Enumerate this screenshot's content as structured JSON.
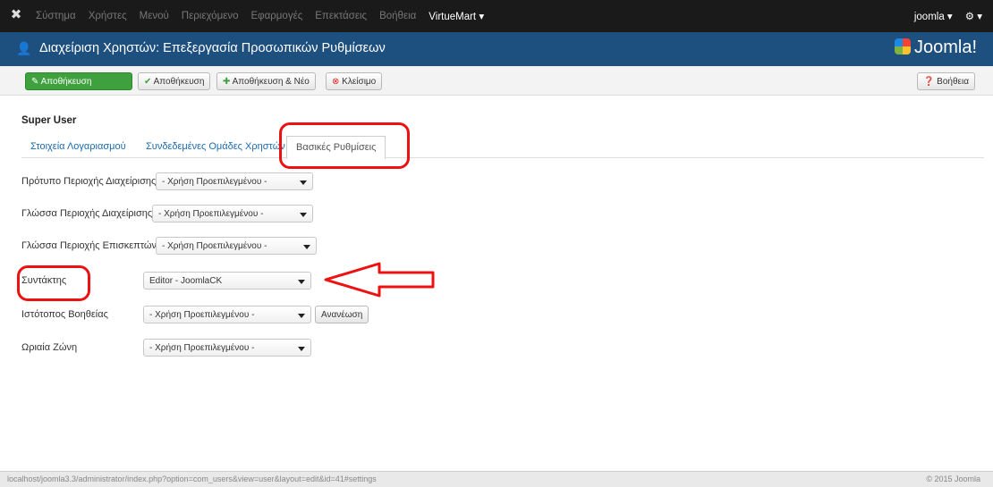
{
  "topnav": {
    "items": [
      "Σύστημα",
      "Χρήστες",
      "Μενού",
      "Περιεχόμενο",
      "Εφαρμογές",
      "Επεκτάσεις",
      "Βοήθεια",
      "VirtueMart ▾"
    ],
    "user": "joomla ▾",
    "gear": "⚙ ▾"
  },
  "titlebar": {
    "title": "Διαχείριση Χρηστών: Επεξεργασία Προσωπικών Ρυθμίσεων",
    "brand": "Joomla!"
  },
  "toolbar": {
    "save": "Αποθήκευση",
    "save2": "Αποθήκευση",
    "save_new": "Αποθήκευση & Νέο",
    "close": "Κλείσιμο",
    "help": "Βοήθεια"
  },
  "page": {
    "user": "Super User"
  },
  "tabs": [
    "Στοιχεία Λογαριασμού",
    "Συνδεδεμένες Ομάδες Χρηστών",
    "Βασικές Ρυθμίσεις"
  ],
  "fields": [
    {
      "label": "Πρότυπο Περιοχής Διαχείρισης",
      "value": "- Χρήση Προεπιλεγμένου -"
    },
    {
      "label": "Γλώσσα Περιοχής Διαχείρισης",
      "value": "- Χρήση Προεπιλεγμένου -"
    },
    {
      "label": "Γλώσσα Περιοχής Επισκεπτών",
      "value": "- Χρήση Προεπιλεγμένου -"
    },
    {
      "label": "Συντάκτης",
      "value": "Editor - JoomlaCK"
    },
    {
      "label": "Ιστότοπος Βοηθείας",
      "value": "- Χρήση Προεπιλεγμένου -",
      "button": "Ανανέωση"
    },
    {
      "label": "Ωριαία Ζώνη",
      "value": "- Χρήση Προεπιλεγμένου -"
    }
  ],
  "status": {
    "url": "localhost/joomla3.3/administrator/index.php?option=com_users&view=user&layout=edit&id=41#settings",
    "copyright": "© 2015 Joomla"
  }
}
